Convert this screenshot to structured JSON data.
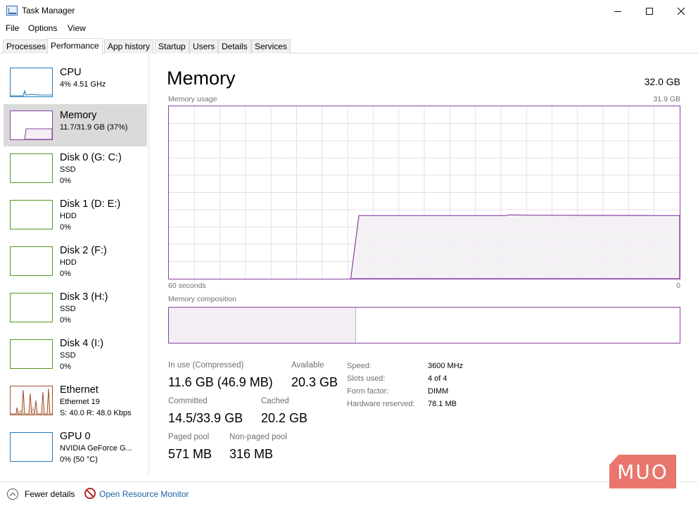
{
  "window": {
    "title": "Task Manager",
    "controls": {
      "minimize_icon": "minimize-icon",
      "maximize_icon": "maximize-icon",
      "close_icon": "close-icon"
    }
  },
  "menu": [
    "File",
    "Options",
    "View"
  ],
  "tabs": [
    {
      "label": "Processes",
      "active": false
    },
    {
      "label": "Performance",
      "active": true
    },
    {
      "label": "App history",
      "active": false
    },
    {
      "label": "Startup",
      "active": false
    },
    {
      "label": "Users",
      "active": false
    },
    {
      "label": "Details",
      "active": false
    },
    {
      "label": "Services",
      "active": false
    }
  ],
  "sidebar": {
    "items": [
      {
        "name": "CPU",
        "sub1": "4%  4.51 GHz",
        "sub2": "",
        "color": "#1f7ab8",
        "active": false
      },
      {
        "name": "Memory",
        "sub1": "11.7/31.9 GB (37%)",
        "sub2": "",
        "color": "#8b3fa1",
        "active": true
      },
      {
        "name": "Disk 0 (G: C:)",
        "sub1": "SSD",
        "sub2": "0%",
        "color": "#4e9a22",
        "active": false
      },
      {
        "name": "Disk 1 (D: E:)",
        "sub1": "HDD",
        "sub2": "0%",
        "color": "#4e9a22",
        "active": false
      },
      {
        "name": "Disk 2 (F:)",
        "sub1": "HDD",
        "sub2": "0%",
        "color": "#4e9a22",
        "active": false
      },
      {
        "name": "Disk 3 (H:)",
        "sub1": "SSD",
        "sub2": "0%",
        "color": "#4e9a22",
        "active": false
      },
      {
        "name": "Disk 4 (I:)",
        "sub1": "SSD",
        "sub2": "0%",
        "color": "#4e9a22",
        "active": false
      },
      {
        "name": "Ethernet",
        "sub1": "Ethernet 19",
        "sub2": "S: 40.0  R: 48.0 Kbps",
        "color": "#a0522d",
        "active": false
      },
      {
        "name": "GPU 0",
        "sub1": "NVIDIA GeForce G...",
        "sub2": "0%  (50 °C)",
        "color": "#1f7ab8",
        "active": false
      }
    ]
  },
  "main": {
    "title": "Memory",
    "total": "32.0 GB",
    "usage_label": "Memory usage",
    "usage_max": "31.9 GB",
    "axis_left": "60 seconds",
    "axis_right": "0",
    "composition_label": "Memory composition",
    "composition_in_use_fraction": 0.366,
    "usage_level_fraction": 0.366,
    "stats": {
      "in_use_label": "In use (Compressed)",
      "in_use_value": "11.6 GB (46.9 MB)",
      "available_label": "Available",
      "available_value": "20.3 GB",
      "committed_label": "Committed",
      "committed_value": "14.5/33.9 GB",
      "cached_label": "Cached",
      "cached_value": "20.2 GB",
      "paged_label": "Paged pool",
      "paged_value": "571 MB",
      "nonpaged_label": "Non-paged pool",
      "nonpaged_value": "316 MB"
    },
    "specs": {
      "speed_label": "Speed:",
      "speed_value": "3600 MHz",
      "slots_label": "Slots used:",
      "slots_value": "4 of 4",
      "form_label": "Form factor:",
      "form_value": "DIMM",
      "hwres_label": "Hardware reserved:",
      "hwres_value": "78.1 MB"
    }
  },
  "footer": {
    "fewer_details": "Fewer details",
    "resource_monitor": "Open Resource Monitor"
  },
  "watermark": "MUO",
  "colors": {
    "memory": "#8b3fa1",
    "memory_fill": "#f2eef3",
    "grid": "#e8dcea",
    "selected": "#dadada"
  }
}
